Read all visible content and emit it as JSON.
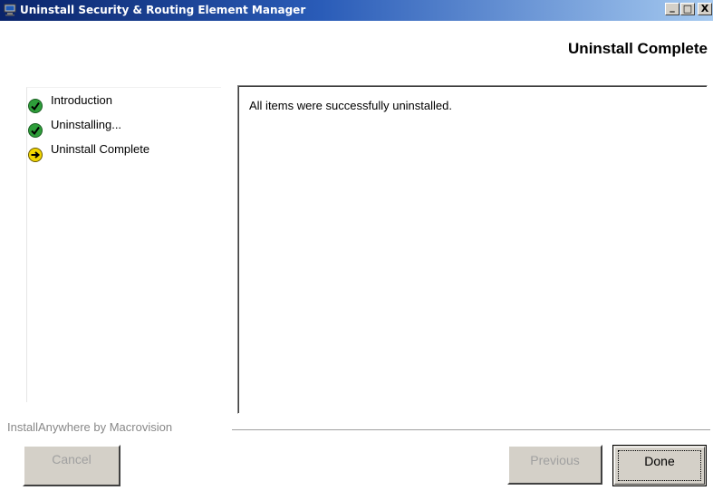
{
  "window": {
    "title": "Uninstall Security & Routing Element Manager",
    "controls": {
      "minimize": "_",
      "maximize": "□",
      "close": "X"
    }
  },
  "header": {
    "title": "Uninstall Complete"
  },
  "steps": [
    {
      "label": "Introduction",
      "status": "done",
      "icon": "check-circle-icon"
    },
    {
      "label": "Uninstalling...",
      "status": "done",
      "icon": "check-circle-icon"
    },
    {
      "label": "Uninstall Complete",
      "status": "current",
      "icon": "arrow-circle-icon"
    }
  ],
  "content": {
    "message": "All items were successfully uninstalled."
  },
  "footer": {
    "brand": "InstallAnywhere by Macrovision",
    "cancel_label": "Cancel",
    "previous_label": "Previous",
    "done_label": "Done"
  },
  "colors": {
    "titlebar_start": "#0a246a",
    "titlebar_end": "#a6caf0",
    "done_green": "#2e9e3a",
    "current_yellow": "#f2d600",
    "button_face": "#d4d0c8"
  }
}
